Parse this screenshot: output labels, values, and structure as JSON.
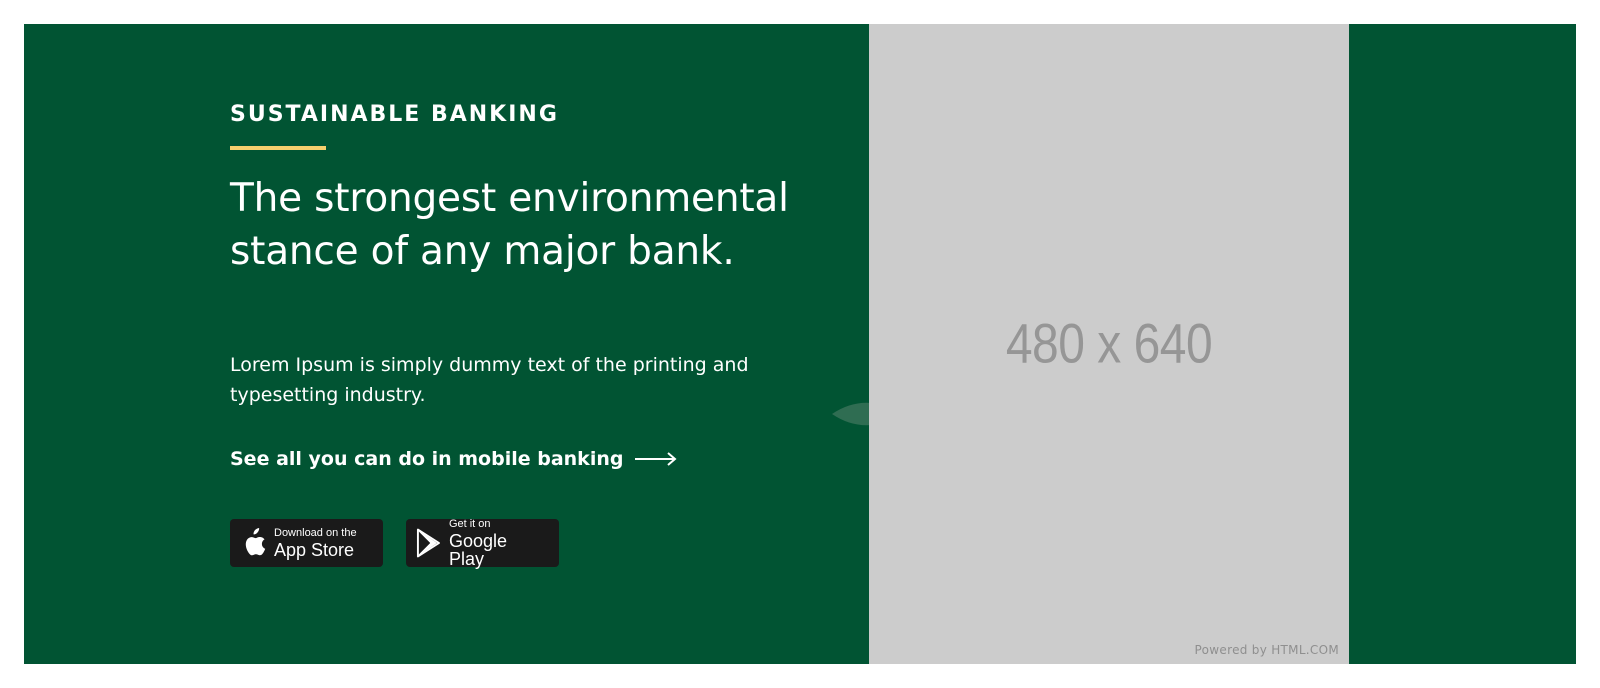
{
  "colors": {
    "background": "#015433",
    "accent": "#f6cf6e",
    "text": "#ffffff",
    "store_button": "#1a1a1a",
    "placeholder": "#cccccc"
  },
  "hero": {
    "eyebrow": "SUSTAINABLE BANKING",
    "headline": "The strongest environmental stance of any major bank.",
    "body": "Lorem Ipsum is simply dummy text of the printing and typesetting industry.",
    "cta_label": "See all you can do in mobile banking",
    "cta_icon": "arrow-right-icon"
  },
  "stores": {
    "apple": {
      "small": "Download on the",
      "big": "App Store",
      "icon": "apple-icon"
    },
    "google": {
      "small": "Get it on",
      "big": "Google Play",
      "icon": "google-play-icon"
    }
  },
  "image_placeholder": {
    "label": "480 x 640",
    "powered_by": "Powered by HTML.COM"
  }
}
